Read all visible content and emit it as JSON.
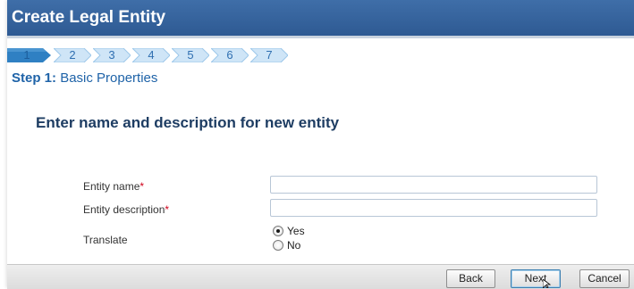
{
  "title": "Create Legal Entity",
  "wizard": {
    "steps": [
      {
        "label": "1",
        "active": true
      },
      {
        "label": "2",
        "active": false
      },
      {
        "label": "3",
        "active": false
      },
      {
        "label": "4",
        "active": false
      },
      {
        "label": "5",
        "active": false
      },
      {
        "label": "6",
        "active": false
      },
      {
        "label": "7",
        "active": false
      }
    ],
    "step_prefix": "Step 1:",
    "step_name": "Basic Properties",
    "section_title": "Enter name and description for new entity"
  },
  "form": {
    "entity_name": {
      "label": "Entity name",
      "required_mark": "*",
      "value": ""
    },
    "entity_description": {
      "label": "Entity description",
      "required_mark": "*",
      "value": ""
    },
    "translate": {
      "label": "Translate",
      "options": [
        {
          "label": "Yes",
          "selected": true
        },
        {
          "label": "No",
          "selected": false
        }
      ]
    }
  },
  "footer": {
    "back_label": "Back",
    "next_label": "Next",
    "cancel_label": "Cancel"
  },
  "colors": {
    "title_bar": "#33629c",
    "step_active": "#2f80c3",
    "step_inactive": "#cfe5f7",
    "required": "#d0021b",
    "heading": "#1e3d63"
  }
}
